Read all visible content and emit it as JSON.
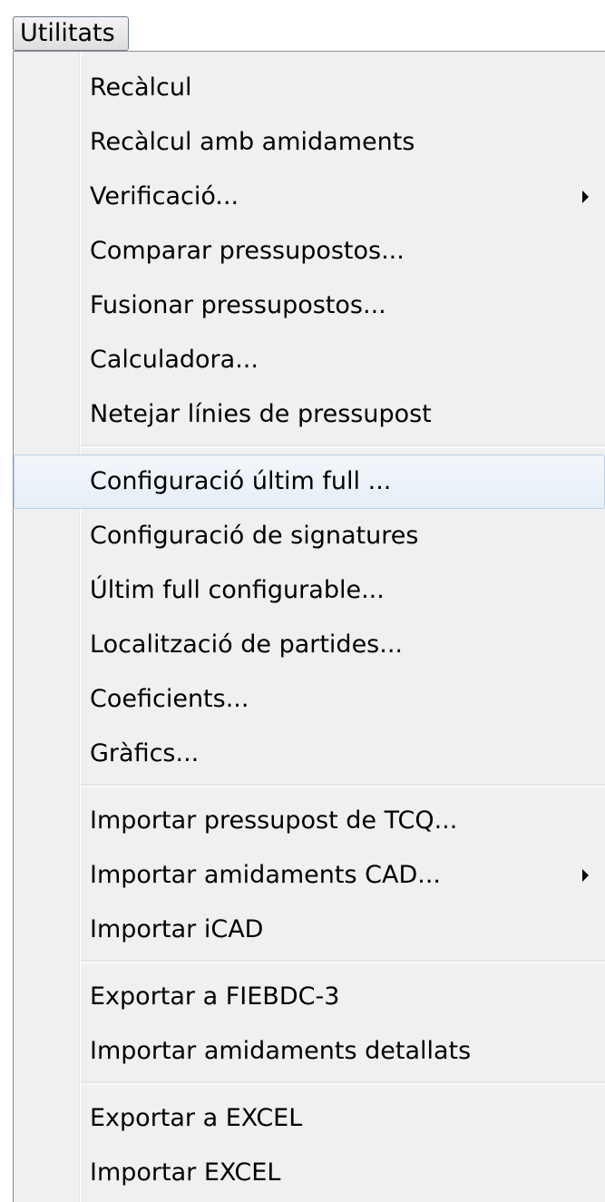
{
  "menubar": {
    "utilitats_label": "Utilitats"
  },
  "menu": {
    "items": [
      {
        "label": "Recàlcul"
      },
      {
        "label": "Recàlcul amb amidaments"
      },
      {
        "label": "Verificació...",
        "submenu": true
      },
      {
        "label": "Comparar pressupostos..."
      },
      {
        "label": "Fusionar pressupostos..."
      },
      {
        "label": "Calculadora..."
      },
      {
        "label": "Netejar línies de pressupost"
      },
      {
        "label": "Configuració últim full ...",
        "highlighted": true
      },
      {
        "label": "Configuració de signatures"
      },
      {
        "label": "Últim full configurable..."
      },
      {
        "label": "Localització de partides..."
      },
      {
        "label": "Coeficients..."
      },
      {
        "label": "Gràfics..."
      },
      {
        "label": "Importar pressupost de TCQ..."
      },
      {
        "label": "Importar amidaments CAD...",
        "submenu": true
      },
      {
        "label": "Importar iCAD"
      },
      {
        "label": "Exportar a FIEBDC-3"
      },
      {
        "label": "Importar amidaments detallats"
      },
      {
        "label": "Exportar a EXCEL"
      },
      {
        "label": "Importar EXCEL"
      }
    ],
    "submenu_arrow_icon": "triangle-right-icon",
    "highlight_color": "#e6eef7"
  }
}
